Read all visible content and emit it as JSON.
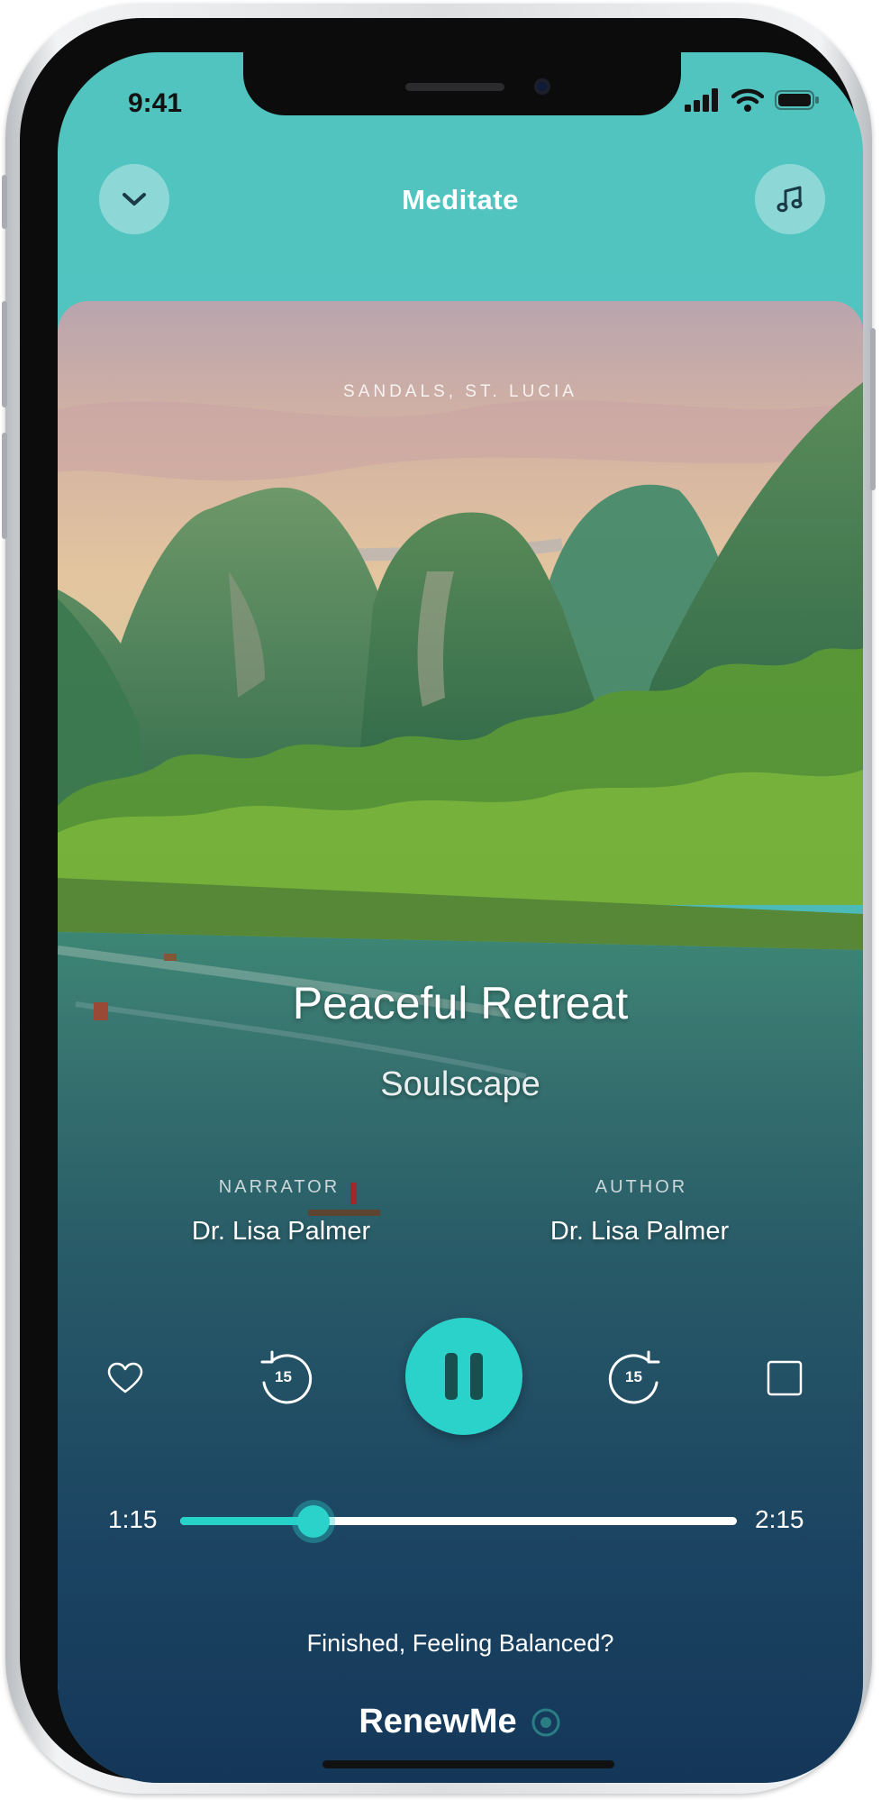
{
  "status_bar": {
    "time": "9:41"
  },
  "header": {
    "title": "Meditate",
    "collapse_icon": "chevron-down-icon",
    "music_icon": "music-note-icon"
  },
  "session": {
    "location": "SANDALS, ST. LUCIA",
    "title": "Peaceful Retreat",
    "subtitle": "Soulscape",
    "narrator_label": "NARRATOR",
    "narrator_name": "Dr. Lisa Palmer",
    "author_label": "AUTHOR",
    "author_name": "Dr. Lisa Palmer"
  },
  "controls": {
    "skip_back_label": "15",
    "skip_forward_label": "15",
    "state": "playing"
  },
  "progress": {
    "elapsed": "1:15",
    "total": "2:15",
    "fraction": 0.24
  },
  "footer": {
    "finished_text": "Finished, Feeling Balanced?",
    "brand": "RenewMe"
  },
  "colors": {
    "accent": "#2ad2ca",
    "header_bg": "#51c4c0"
  }
}
